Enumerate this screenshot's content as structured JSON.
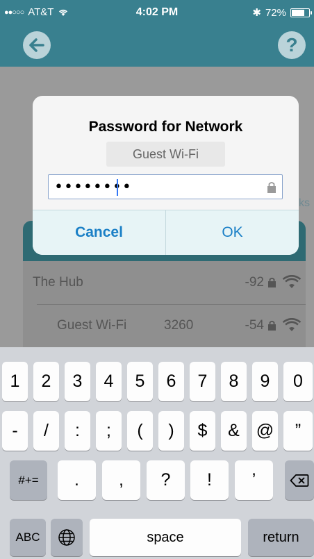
{
  "status_bar": {
    "carrier": "AT&T",
    "time": "4:02 PM",
    "battery": "72%",
    "battery_level": 0.72
  },
  "nav": {
    "back_icon": "arrow-left-icon",
    "help_icon": "help-icon",
    "help_glyph": "?"
  },
  "background": {
    "hint_text": "ks",
    "networks": [
      {
        "name": "The Hub",
        "channel": "",
        "rssi": "-92"
      },
      {
        "name": "Guest Wi-Fi",
        "channel": "3260",
        "rssi": "-54"
      }
    ]
  },
  "alert": {
    "title": "Password for Network",
    "network_name": "Guest Wi-Fi",
    "password_value": "••••••••",
    "cancel_label": "Cancel",
    "ok_label": "OK"
  },
  "keyboard": {
    "row1": [
      "1",
      "2",
      "3",
      "4",
      "5",
      "6",
      "7",
      "8",
      "9",
      "0"
    ],
    "row2": [
      "-",
      "/",
      ":",
      ";",
      "(",
      ")",
      "$",
      "&",
      "@",
      "”"
    ],
    "row3": [
      ".",
      ",",
      "?",
      "!",
      "’"
    ],
    "more_symbols": "#+=",
    "abc": "ABC",
    "space": "space",
    "return": "return"
  }
}
